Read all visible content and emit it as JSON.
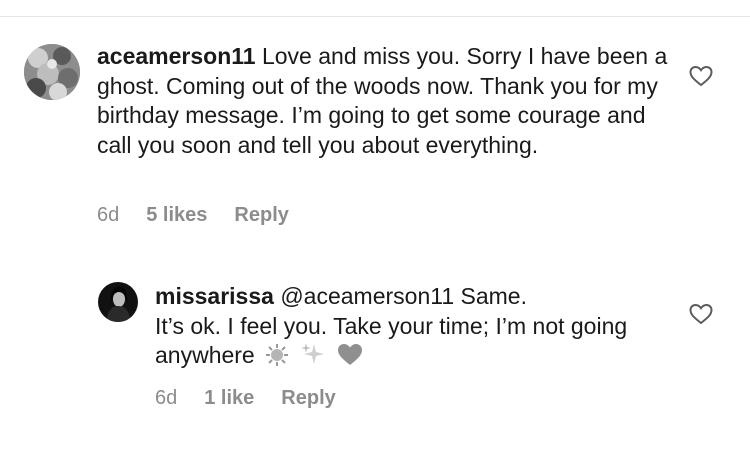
{
  "comments": [
    {
      "username": "aceamerson11",
      "text": "Love and miss you. Sorry I have been a ghost. Coming out of the woods now. Thank you for my birthday message. I’m going to get some courage and call you soon and tell you about everything.",
      "age": "6d",
      "likes": "5 likes",
      "reply": "Reply",
      "like_icon": "heart-outline-icon"
    },
    {
      "username": "missarissa",
      "mention": "@aceamerson11",
      "text_line1": "Same.",
      "text_rest": "It’s ok. I feel you. Take your time; I’m not going anywhere",
      "emojis": [
        "sun-icon",
        "sparkles-icon",
        "heart-icon"
      ],
      "age": "6d",
      "likes": "1 like",
      "reply": "Reply",
      "like_icon": "heart-outline-icon"
    }
  ]
}
